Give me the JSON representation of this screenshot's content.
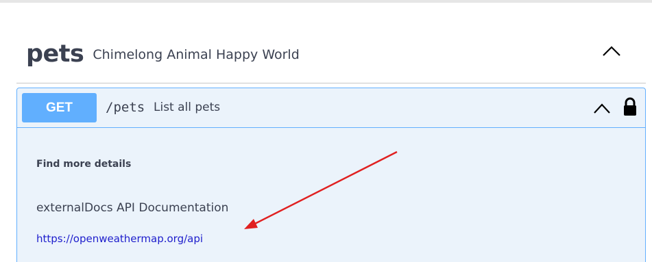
{
  "tag": {
    "name": "pets",
    "description": "Chimelong Animal Happy World"
  },
  "operation": {
    "method": "GET",
    "path": "/pets",
    "summary": "List all pets",
    "details_title": "Find more details",
    "external_docs_description": "externalDocs API Documentation",
    "external_docs_url": "https://openweathermap.org/api"
  },
  "icons": {
    "tag_toggle": "chevron-up-icon",
    "op_toggle": "chevron-up-icon",
    "auth": "lock-icon"
  },
  "colors": {
    "get_method": "#61affe",
    "opblock_bg": "#ebf3fb",
    "text": "#3b4151",
    "link": "#1d1dcc",
    "annotation_arrow": "#e02020"
  }
}
